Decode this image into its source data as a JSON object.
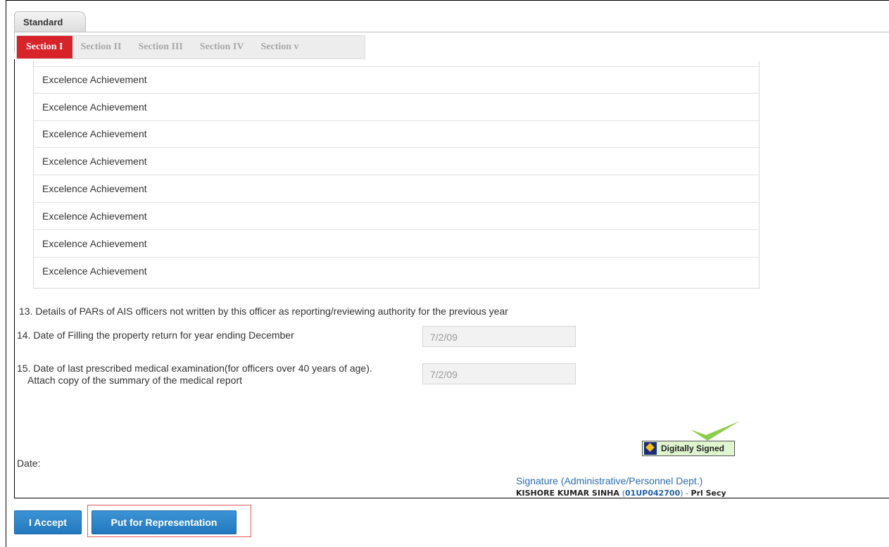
{
  "tabs": {
    "top_tab": "Standard",
    "sections": [
      "Section I",
      "Section II",
      "Section III",
      "Section IV",
      "Section v"
    ],
    "active_section": "Section I"
  },
  "achievements": [
    "Excelence Achievement",
    "Excelence Achievement",
    "Excelence Achievement",
    "Excelence Achievement",
    "Excelence Achievement",
    "Excelence Achievement",
    "Excelence Achievement",
    "Excelence Achievement"
  ],
  "questions": {
    "q13": "13. Details of PARs of AIS officers not written by this officer as reporting/reviewing authority for the previous year",
    "q14": "14. Date of Filling the property return for year ending December",
    "q14_value": "7/2/09",
    "q15_line1": "15. Date of last prescribed medical examination(for officers over 40 years of age).",
    "q15_line2": "Attach copy of the summary of the medical report",
    "q15_value": "7/2/09"
  },
  "signature": {
    "date_label": "Date:",
    "digital_badge": "Digitally Signed",
    "title": "Signature (Administrative/Personnel Dept.)",
    "name": "KISHORE KUMAR SINHA",
    "code_open": "(",
    "code": "01UP042700",
    "code_close": ")",
    "dash": " - ",
    "designation": "Prl Secy"
  },
  "buttons": {
    "accept": "I Accept",
    "representation": "Put for Representation"
  },
  "colors": {
    "active_tab": "#d7242b",
    "button": "#2278be",
    "signature_text": "#2a6db5",
    "badge_bg": "#dff6d1",
    "checkmark": "#8ccd4a"
  }
}
